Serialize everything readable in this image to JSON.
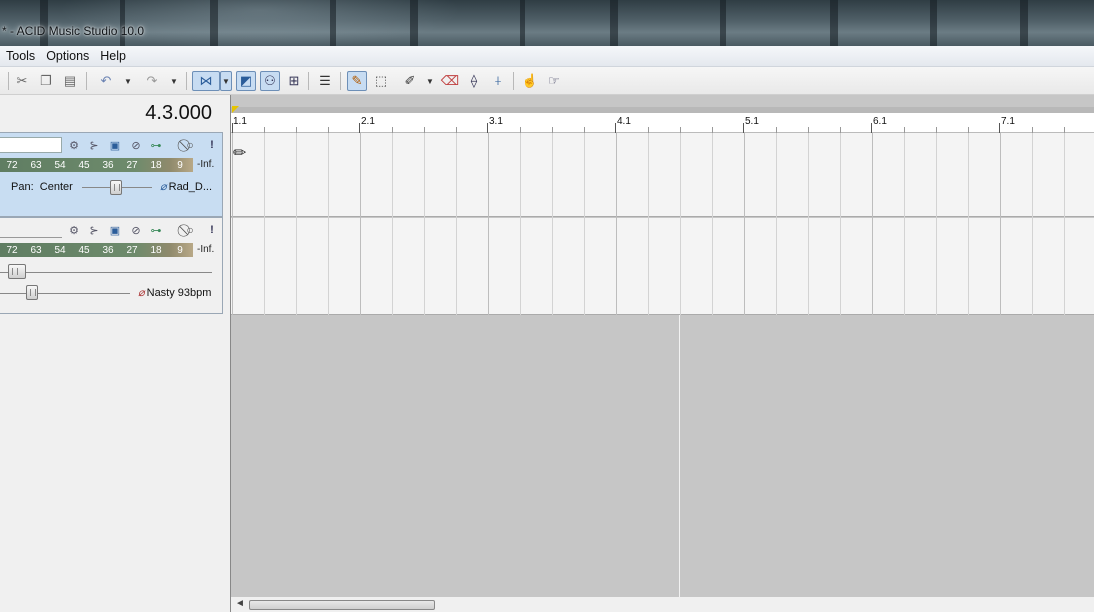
{
  "window": {
    "title": "* - ACID Music Studio 10.0"
  },
  "menu": {
    "items": [
      "Tools",
      "Options",
      "Help"
    ]
  },
  "transport": {
    "time": "4.3.000"
  },
  "tracks": [
    {
      "meter_scale": [
        "72",
        "63",
        "54",
        "45",
        "36",
        "27",
        "18",
        "9"
      ],
      "level": "-Inf.",
      "pan_label": "Pan:",
      "pan_value": "Center",
      "clip_name": "Rad_D..."
    },
    {
      "meter_scale": [
        "72",
        "63",
        "54",
        "45",
        "36",
        "27",
        "18",
        "9"
      ],
      "level": "-Inf.",
      "clip_name": "Nasty 93bpm"
    }
  ],
  "ruler": {
    "bars": [
      "1.1",
      "2.1",
      "3.1",
      "4.1",
      "5.1",
      "6.1",
      "7.1"
    ]
  },
  "icons": {
    "toolbar": [
      "cut-icon",
      "copy-icon",
      "paste-icon",
      "undo-icon",
      "redo-icon",
      "auto-ripple-icon",
      "snap-icon",
      "grid-icon",
      "lock-envelope-icon",
      "event-icon",
      "draw-tool-icon",
      "selection-tool-icon",
      "paint-icon",
      "erase-icon",
      "envelope-tool-icon",
      "split-icon",
      "zoom-tool-icon",
      "scrub-icon"
    ]
  },
  "colors": {
    "selected_track": "#c8ddf2",
    "meter": "#6e8b6c",
    "timeline_bg": "#c6c6c6"
  }
}
